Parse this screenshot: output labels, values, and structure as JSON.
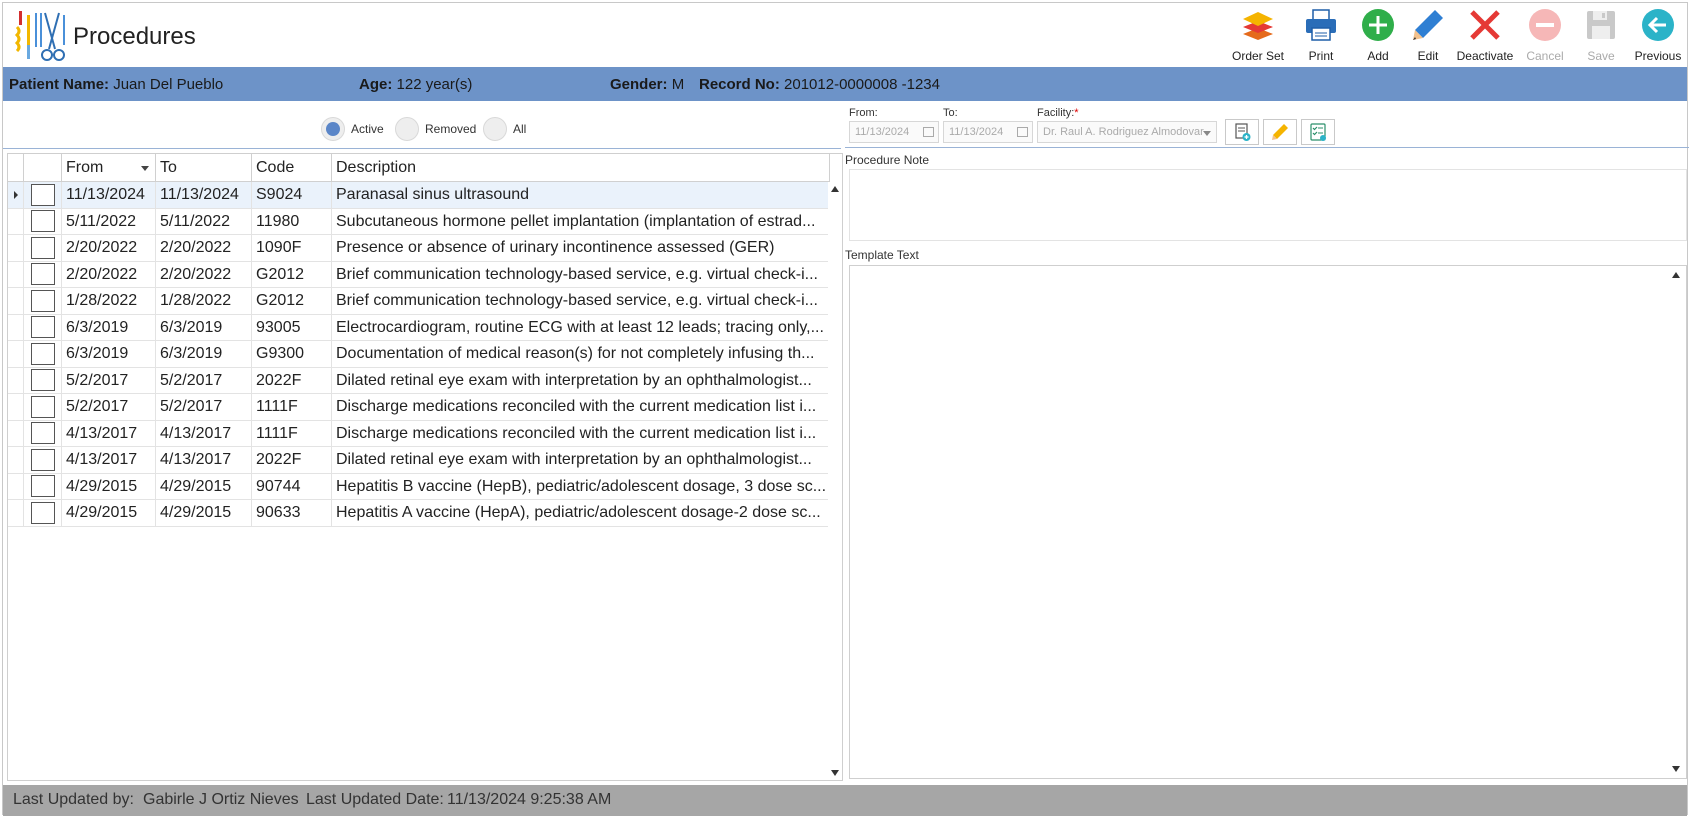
{
  "header": {
    "title": "Procedures",
    "logo_icon": "surgical-instruments-icon",
    "toolbar": [
      {
        "key": "order_set",
        "label": "Order Set",
        "icon": "layers-icon",
        "enabled": true
      },
      {
        "key": "print",
        "label": "Print",
        "icon": "printer-icon",
        "enabled": true
      },
      {
        "key": "add",
        "label": "Add",
        "icon": "plus-circle-icon",
        "enabled": true
      },
      {
        "key": "edit",
        "label": "Edit",
        "icon": "pencil-icon",
        "enabled": true
      },
      {
        "key": "deactivate",
        "label": "Deactivate",
        "icon": "x-icon",
        "enabled": true
      },
      {
        "key": "cancel",
        "label": "Cancel",
        "icon": "minus-circle-icon",
        "enabled": false
      },
      {
        "key": "save",
        "label": "Save",
        "icon": "floppy-icon",
        "enabled": false
      },
      {
        "key": "previous",
        "label": "Previous",
        "icon": "arrow-left-circle-icon",
        "enabled": true
      }
    ]
  },
  "patient": {
    "name_label": "Patient Name:",
    "name": "Juan Del Pueblo",
    "age_label": "Age:",
    "age": "122 year(s)",
    "gender_label": "Gender:",
    "gender": "M",
    "record_label": "Record No:",
    "record": "201012-0000008 -1234"
  },
  "filter": {
    "options": [
      "Active",
      "Removed",
      "All"
    ],
    "selected": "Active"
  },
  "grid": {
    "columns": [
      "From",
      "To",
      "Code",
      "Description"
    ],
    "rows": [
      {
        "from": "11/13/2024",
        "to": "11/13/2024",
        "code": "S9024",
        "description": "Paranasal sinus ultrasound"
      },
      {
        "from": "5/11/2022",
        "to": "5/11/2022",
        "code": "11980",
        "description": "Subcutaneous hormone pellet implantation (implantation of estrad..."
      },
      {
        "from": "2/20/2022",
        "to": "2/20/2022",
        "code": "1090F",
        "description": "Presence or absence of urinary incontinence assessed (GER)"
      },
      {
        "from": "2/20/2022",
        "to": "2/20/2022",
        "code": "G2012",
        "description": "Brief communication technology-based service, e.g. virtual check-i..."
      },
      {
        "from": "1/28/2022",
        "to": "1/28/2022",
        "code": "G2012",
        "description": "Brief communication technology-based service, e.g. virtual check-i..."
      },
      {
        "from": "6/3/2019",
        "to": "6/3/2019",
        "code": "93005",
        "description": "Electrocardiogram, routine ECG with at least 12 leads; tracing only,..."
      },
      {
        "from": "6/3/2019",
        "to": "6/3/2019",
        "code": "G9300",
        "description": "Documentation of medical reason(s) for not completely infusing th..."
      },
      {
        "from": "5/2/2017",
        "to": "5/2/2017",
        "code": "2022F",
        "description": "Dilated retinal eye exam with interpretation by an ophthalmologist..."
      },
      {
        "from": "5/2/2017",
        "to": "5/2/2017",
        "code": "1111F",
        "description": "Discharge medications reconciled with the current medication list i..."
      },
      {
        "from": "4/13/2017",
        "to": "4/13/2017",
        "code": "1111F",
        "description": "Discharge medications reconciled with the current medication list i..."
      },
      {
        "from": "4/13/2017",
        "to": "4/13/2017",
        "code": "2022F",
        "description": "Dilated retinal eye exam with interpretation by an ophthalmologist..."
      },
      {
        "from": "4/29/2015",
        "to": "4/29/2015",
        "code": "90744",
        "description": "Hepatitis B vaccine (HepB), pediatric/adolescent dosage, 3 dose sc..."
      },
      {
        "from": "4/29/2015",
        "to": "4/29/2015",
        "code": "90633",
        "description": "Hepatitis A vaccine (HepA), pediatric/adolescent dosage-2 dose sc..."
      }
    ]
  },
  "detail": {
    "from_label": "From:",
    "from_value": "11/13/2024",
    "to_label": "To:",
    "to_value": "11/13/2024",
    "facility_label": "Facility:",
    "facility_required": "*",
    "facility_value": "Dr. Raul A. Rodriguez Almodovar",
    "procedure_note_label": "Procedure Note",
    "procedure_note": "",
    "template_text_label": "Template Text",
    "template_text": ""
  },
  "footer": {
    "updated_by_label": "Last Updated by:",
    "updated_by": "Gabirle J Ortiz Nieves",
    "updated_date_label": "Last Updated Date:",
    "updated_date": "11/13/2024 9:25:38 AM"
  },
  "colors": {
    "patient_bar": "#6d93c8",
    "footer": "#a6a6a6",
    "add_green": "#2fae4a",
    "deactivate_red": "#e53935",
    "edit_blue": "#2f7fd3",
    "previous_teal": "#2bb3c8"
  }
}
